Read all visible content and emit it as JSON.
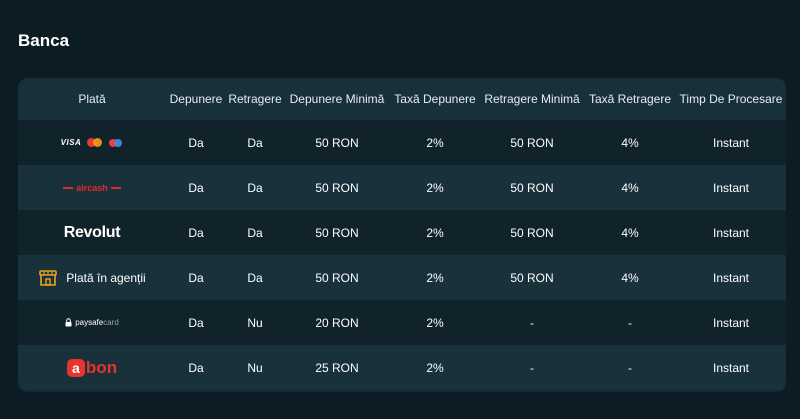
{
  "section": {
    "title": "Banca"
  },
  "table": {
    "headers": [
      "Plată",
      "Depunere",
      "Retragere",
      "Depunere Minimă",
      "Taxă Depunere",
      "Retragere Minimă",
      "Taxă Retragere",
      "Timp De Procesare"
    ],
    "rows": [
      {
        "method": "VISA",
        "logo_icon": "visa-mastercard-maestro-logo",
        "deposit": "Da",
        "withdrawal": "Da",
        "min_deposit": "50 RON",
        "deposit_fee": "2%",
        "min_withdrawal": "50 RON",
        "withdrawal_fee": "4%",
        "processing": "Instant"
      },
      {
        "method": "aircash",
        "logo_icon": "aircash-logo",
        "deposit": "Da",
        "withdrawal": "Da",
        "min_deposit": "50 RON",
        "deposit_fee": "2%",
        "min_withdrawal": "50 RON",
        "withdrawal_fee": "4%",
        "processing": "Instant"
      },
      {
        "method": "Revolut",
        "logo_icon": "revolut-logo",
        "deposit": "Da",
        "withdrawal": "Da",
        "min_deposit": "50 RON",
        "deposit_fee": "2%",
        "min_withdrawal": "50 RON",
        "withdrawal_fee": "4%",
        "processing": "Instant"
      },
      {
        "method": "Plată în agenții",
        "logo_icon": "store-icon",
        "deposit": "Da",
        "withdrawal": "Da",
        "min_deposit": "50 RON",
        "deposit_fee": "2%",
        "min_withdrawal": "50 RON",
        "withdrawal_fee": "4%",
        "processing": "Instant"
      },
      {
        "method": "paysafe",
        "method_suffix": "card",
        "logo_icon": "paysafecard-logo",
        "deposit": "Da",
        "withdrawal": "Nu",
        "min_deposit": "20 RON",
        "deposit_fee": "2%",
        "min_withdrawal": "-",
        "withdrawal_fee": "-",
        "processing": "Instant"
      },
      {
        "method_prefix": "a",
        "method": "bon",
        "logo_icon": "abon-logo",
        "deposit": "Da",
        "withdrawal": "Nu",
        "min_deposit": "25 RON",
        "deposit_fee": "2%",
        "min_withdrawal": "-",
        "withdrawal_fee": "-",
        "processing": "Instant"
      }
    ]
  },
  "colors": {
    "background": "#0c1c24",
    "header_row": "#18303a",
    "row_dark": "#10232b",
    "row_light": "#18313b",
    "aircash_red": "#e02a2a",
    "abon_red": "#e8332e",
    "store_orange": "#f0a020"
  }
}
